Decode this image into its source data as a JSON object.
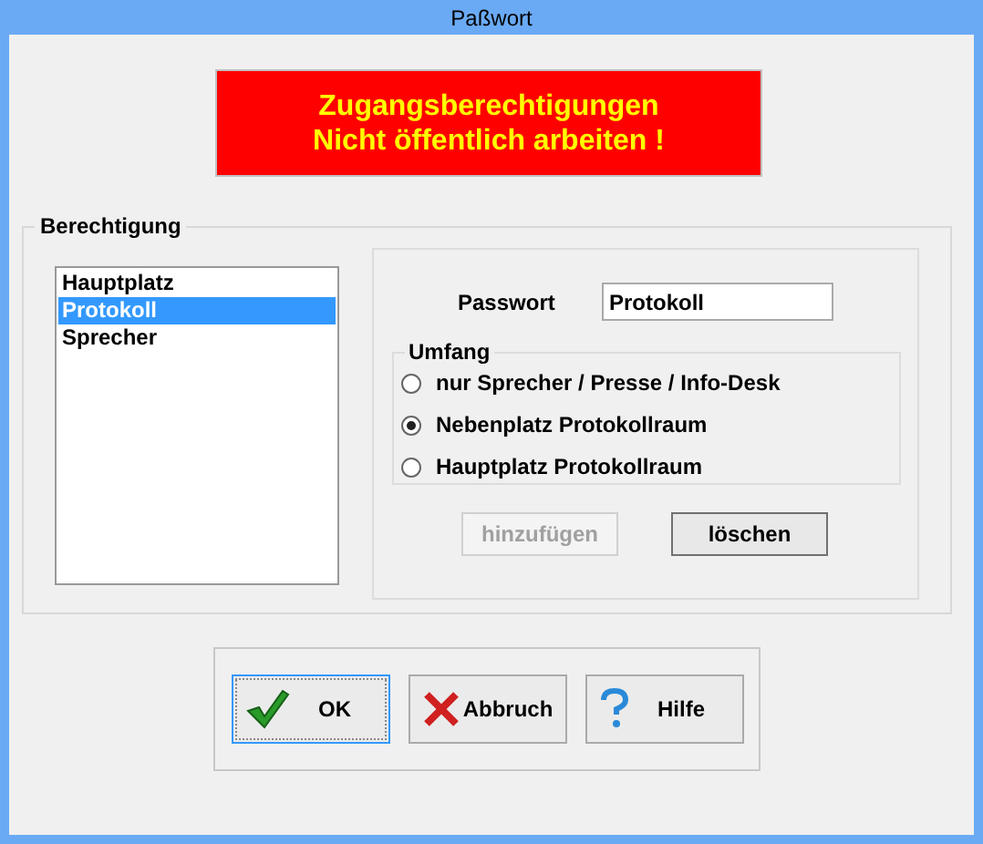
{
  "window": {
    "title": "Paßwort"
  },
  "banner": {
    "lines": [
      "Zugangsberechtigungen",
      "Nicht öffentlich arbeiten !"
    ]
  },
  "group": {
    "title": "Berechtigung"
  },
  "list": [
    {
      "label": "Hauptplatz",
      "selected": false
    },
    {
      "label": "Protokoll",
      "selected": true
    },
    {
      "label": "Sprecher",
      "selected": false
    }
  ],
  "password": {
    "label": "Passwort",
    "value": "Protokoll"
  },
  "scope": {
    "title": "Umfang",
    "options": [
      {
        "label": "nur Sprecher / Presse / Info-Desk",
        "selected": false
      },
      {
        "label": "Nebenplatz Protokollraum",
        "selected": true
      },
      {
        "label": "Hauptplatz Protokollraum",
        "selected": false
      }
    ]
  },
  "actions": [
    {
      "label": "hinzufügen",
      "disabled": true
    },
    {
      "label": "löschen",
      "disabled": false
    }
  ],
  "buttons": [
    {
      "label": "OK",
      "kind": "ok",
      "focused": true
    },
    {
      "label": "Abbruch",
      "kind": "cancel",
      "focused": false
    },
    {
      "label": "Hilfe",
      "kind": "help",
      "focused": false
    }
  ]
}
